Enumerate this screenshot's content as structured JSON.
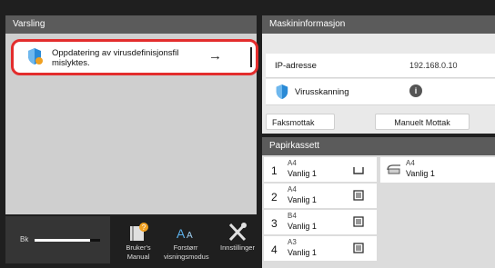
{
  "notification_panel": {
    "title": "Varsling",
    "message": "Oppdatering av virusdefinisjonsfil mislyktes.",
    "arrow_icon": "→"
  },
  "machine_info": {
    "title": "Maskininformasjon",
    "ip_label": "IP-adresse",
    "ip_value": "192.168.0.10",
    "virus_label": "Virusskanning",
    "info_icon": "i",
    "fax_button": "Faksmottak",
    "manual_button": "Manuelt Mottak"
  },
  "paper_tray": {
    "title": "Papirkassett",
    "trays": [
      {
        "number": "1",
        "size": "A4",
        "type": "Vanlig 1"
      },
      {
        "number": "2",
        "size": "A4",
        "type": "Vanlig 1"
      },
      {
        "number": "3",
        "size": "B4",
        "type": "Vanlig 1"
      },
      {
        "number": "4",
        "size": "A3",
        "type": "Vanlig 1"
      }
    ],
    "bypass": {
      "size": "A4",
      "type": "Vanlig 1"
    }
  },
  "toner": {
    "label": "Bk",
    "level": 0.85
  },
  "toolbar": {
    "manual_label": "Bruker's Manual",
    "zoom_label": "Forstørr visningsmodus",
    "settings_label": "Innstillinger"
  },
  "colors": {
    "alert_border": "#e32d2d",
    "header": "#5b5b5b",
    "shield": "#2a8ad6"
  }
}
